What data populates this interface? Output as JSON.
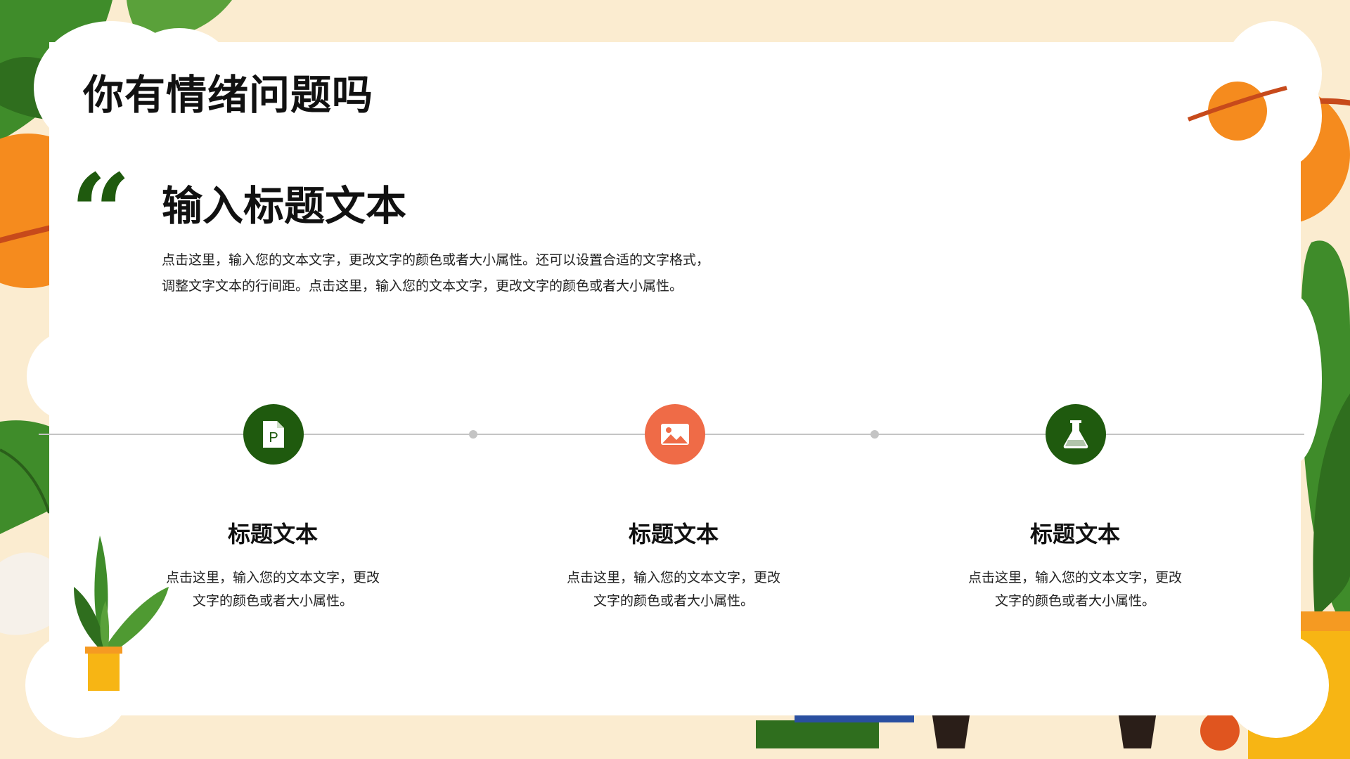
{
  "colors": {
    "background": "#fbecd0",
    "panel": "#ffffff",
    "accent_green": "#1f5a0e",
    "accent_coral": "#ef6b47",
    "line_gray": "#c4c4c4",
    "orange": "#f58b1e",
    "leaf_green": "#3f8c2a"
  },
  "header": {
    "title": "你有情绪问题吗"
  },
  "section": {
    "quote_icon": "quote-icon",
    "title": "输入标题文本",
    "body_line1": "点击这里，输入您的文本文字，更改文字的颜色或者大小属性。还可以设置合适的文字格式，",
    "body_line2": "调整文字文本的行间距。点击这里，输入您的文本文字，更改文字的颜色或者大小属性。"
  },
  "timeline": {
    "items": [
      {
        "icon": "powerpoint-file-icon",
        "title": "标题文本",
        "body_line1": "点击这里，输入您的文本文字，更改",
        "body_line2": "文字的颜色或者大小属性。"
      },
      {
        "icon": "image-icon",
        "title": "标题文本",
        "body_line1": "点击这里，输入您的文本文字，更改",
        "body_line2": "文字的颜色或者大小属性。"
      },
      {
        "icon": "flask-icon",
        "title": "标题文本",
        "body_line1": "点击这里，输入您的文本文字，更改",
        "body_line2": "文字的颜色或者大小属性。"
      }
    ]
  }
}
